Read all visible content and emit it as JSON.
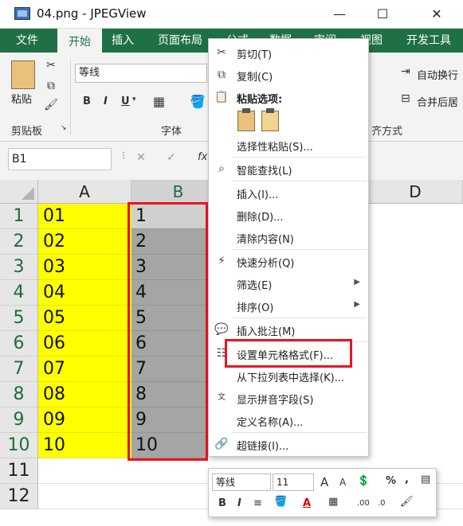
{
  "window": {
    "title": "04.png - JPEGView",
    "minimize": "—",
    "maximize": "☐",
    "close": "✕"
  },
  "ribbon": {
    "tabs": [
      "文件",
      "开始",
      "插入",
      "页面布局",
      "公式",
      "数据",
      "审阅",
      "视图",
      "开发工具"
    ],
    "active_tab": "开始",
    "paste_label": "粘贴",
    "clipboard_label": "剪贴板",
    "font_label": "字体",
    "font_name": "等线",
    "font_bold": "B",
    "font_italic": "I",
    "font_underline": "U",
    "align_label": "齐方式",
    "wrap_text": "自动换行",
    "merge_center": "合并后居"
  },
  "formula_bar": {
    "name_box": "B1",
    "cancel": "✕",
    "enter": "✓",
    "fx": "fx"
  },
  "sheet": {
    "columns": [
      "A",
      "B",
      "D"
    ],
    "rows": [
      "1",
      "2",
      "3",
      "4",
      "5",
      "6",
      "7",
      "8",
      "9",
      "10",
      "11",
      "12"
    ],
    "col_a": [
      "01",
      "02",
      "03",
      "04",
      "05",
      "06",
      "07",
      "08",
      "09",
      "10"
    ],
    "col_b": [
      "1",
      "2",
      "3",
      "4",
      "5",
      "6",
      "7",
      "8",
      "9",
      "10"
    ],
    "selection_color": "#a5a5a5",
    "highlight_color": "#ffff00",
    "annotation_color": "#e8141f"
  },
  "context_menu": {
    "cut": "剪切(T)",
    "copy": "复制(C)",
    "paste_options": "粘贴选项:",
    "paste_special": "选择性粘贴(S)...",
    "smart_lookup": "智能查找(L)",
    "insert": "插入(I)...",
    "delete": "删除(D)...",
    "clear_contents": "清除内容(N)",
    "quick_analysis": "快速分析(Q)",
    "filter": "筛选(E)",
    "sort": "排序(O)",
    "insert_comment": "插入批注(M)",
    "format_cells": "设置单元格格式(F)...",
    "pick_from_list": "从下拉列表中选择(K)...",
    "phonetic": "显示拼音字段(S)",
    "define_name": "定义名称(A)...",
    "hyperlink": "超链接(I)..."
  },
  "mini_toolbar": {
    "font_name": "等线",
    "font_size": "11",
    "increase_font": "A",
    "decrease_font": "A",
    "percent": "%",
    "comma": ",",
    "bold": "B",
    "italic": "I",
    "font_color_letter": "A",
    "dec_increase": ".00",
    "dec_decrease": ".0"
  }
}
